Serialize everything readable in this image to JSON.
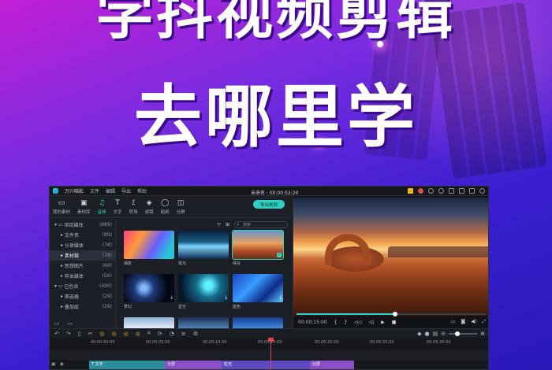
{
  "poster": {
    "headline_top": "学抖视频剪辑",
    "headline_bottom": "去哪里学"
  },
  "window": {
    "app_name": "万兴喵影",
    "menu": [
      "文件",
      "编辑",
      "导出",
      "帮助"
    ],
    "project_title": "未命名 : 00:00:52:20"
  },
  "toolbar": {
    "tools": [
      {
        "label": "我的素材",
        "icon": "folder-icon"
      },
      {
        "label": "素材库",
        "icon": "library-icon"
      },
      {
        "label": "音频",
        "icon": "music-note-icon",
        "active": true
      },
      {
        "label": "文字",
        "icon": "text-icon"
      },
      {
        "label": "转场",
        "icon": "transition-icon"
      },
      {
        "label": "滤镜",
        "icon": "filter-icon"
      },
      {
        "label": "贴纸",
        "icon": "sticker-icon"
      },
      {
        "label": "分屏",
        "icon": "split-screen-icon"
      }
    ],
    "export_label": "导出视频"
  },
  "sidebar": {
    "items": [
      {
        "label": "项目媒体",
        "count": "(889)"
      },
      {
        "label": "文件夹",
        "count": "(89)"
      },
      {
        "label": "分享媒体",
        "count": "(78)"
      },
      {
        "label": "素材箱",
        "count": "(78)"
      },
      {
        "label": "思想图片",
        "count": "(60)"
      },
      {
        "label": "样本媒体",
        "count": "(56)"
      },
      {
        "label": "已包含",
        "count": "(490)"
      },
      {
        "label": "筛选器",
        "count": "(29)"
      },
      {
        "label": "叠加层",
        "count": "(29)"
      }
    ]
  },
  "search": {
    "placeholder": "搜索"
  },
  "media": [
    {
      "label": "抽象"
    },
    {
      "label": "极光"
    },
    {
      "label": "峡谷"
    },
    {
      "label": "梦幻"
    },
    {
      "label": "星空"
    },
    {
      "label": "蓝色"
    },
    {
      "label": ""
    },
    {
      "label": ""
    },
    {
      "label": ""
    }
  ],
  "preview": {
    "timecode": "00:00:15:00",
    "progress": 0.52
  },
  "timeline": {
    "ruler": [
      "00:00:00:00",
      "00:00:05:00",
      "00:00:10:00",
      "00:00:15:00",
      "00:00:20:00",
      "00:00:25:00",
      "00:00:30:00"
    ],
    "clips": [
      {
        "label": "T 文字"
      },
      {
        "label": "分屏"
      },
      {
        "label": "粒光"
      },
      {
        "label": "分屏"
      }
    ]
  }
}
